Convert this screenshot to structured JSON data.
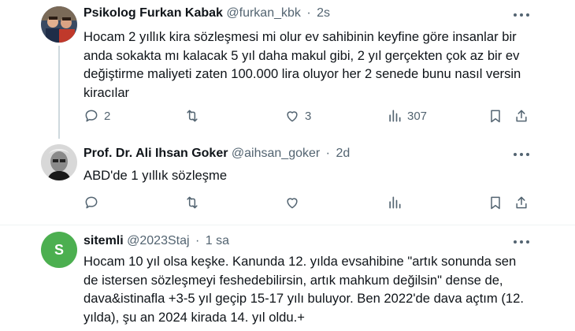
{
  "tweets": [
    {
      "name": "Psikolog Furkan Kabak",
      "handle": "@furkan_kbk",
      "time": "2s",
      "text_lines": [
        "Hocam 2 yıllık kira sözleşmesi mi olur ev sahibinin keyfine göre insanlar bir",
        "anda sokakta mı kalacak 5 yıl daha makul gibi, 2 yıl gerçekten çok az bir ev",
        "değiştirme maliyeti zaten 100.000 lira oluyor her 2 senede bunu nasıl versin",
        "kiracılar"
      ],
      "replies": "2",
      "retweets": "",
      "likes": "3",
      "views": "307"
    },
    {
      "name": "Prof. Dr. Ali Ihsan Goker",
      "handle": "@aihsan_goker",
      "time": "2d",
      "text_lines": [
        "ABD'de 1 yıllık sözleşme"
      ],
      "replies": "",
      "retweets": "",
      "likes": "",
      "views": ""
    },
    {
      "name": "sitemli",
      "handle": "@2023Staj",
      "time": "1 sa",
      "avatar_letter": "S",
      "text_lines": [
        "Hocam 10 yıl olsa keşke. Kanunda 12. yılda evsahibine \"artık sonunda sen",
        "de istersen sözleşmeyi feshedebilirsin, artık mahkum değilsin\" dense de,",
        "dava&istinafla +3-5 yıl geçip 15-17 yılı buluyor. Ben 2022'de dava açtım (12.",
        "yılda), şu an 2024 kirada 14. yıl oldu.+"
      ]
    }
  ],
  "icons": [
    "reply-icon",
    "retweet-icon",
    "like-icon",
    "views-icon",
    "bookmark-icon",
    "share-icon",
    "more-icon"
  ],
  "colors": {
    "text": "#0f1419",
    "muted": "#536471",
    "divider": "#eff3f4",
    "thread": "#cfd9de",
    "avatar_green": "#4caf50"
  }
}
